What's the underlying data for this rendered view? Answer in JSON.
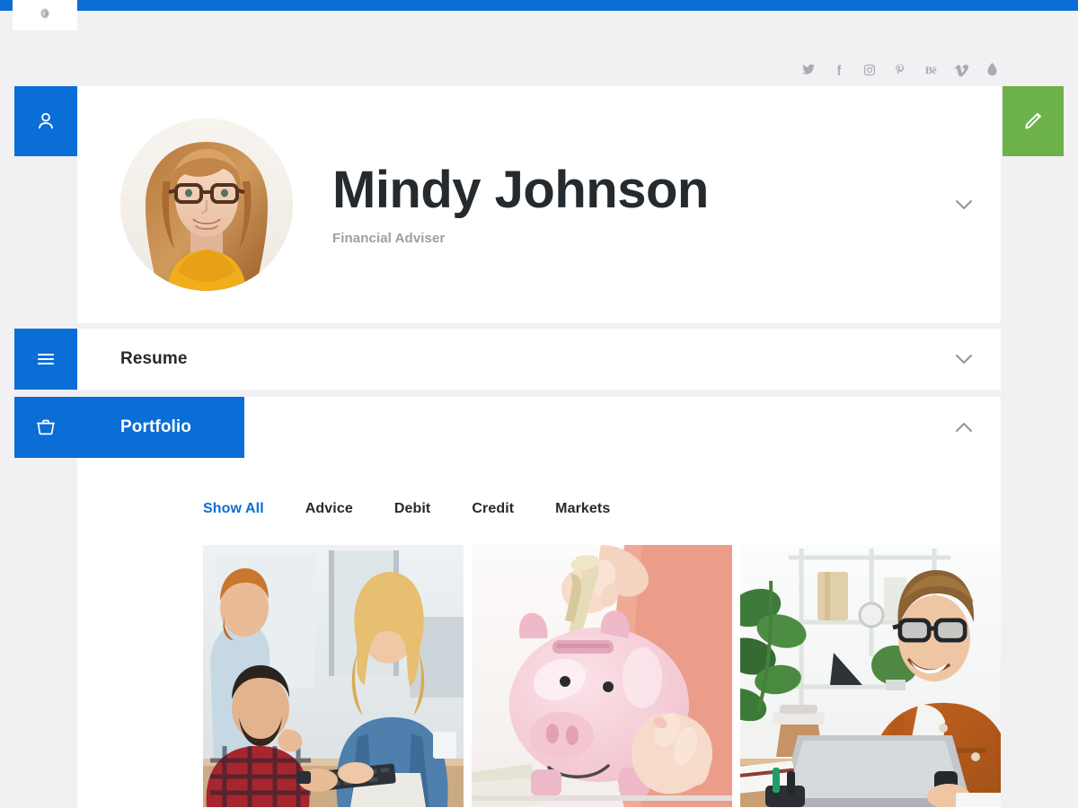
{
  "topbar": {
    "accent_color": "#0a6ed6",
    "brightness_toggle": "brightness-icon"
  },
  "social": {
    "items": [
      {
        "name": "twitter",
        "label": "Twitter"
      },
      {
        "name": "facebook",
        "label": "Facebook"
      },
      {
        "name": "instagram",
        "label": "Instagram"
      },
      {
        "name": "pinterest",
        "label": "Pinterest"
      },
      {
        "name": "behance",
        "label": "Behance"
      },
      {
        "name": "vimeo",
        "label": "Vimeo"
      },
      {
        "name": "dribbble",
        "label": "Dribbble"
      }
    ]
  },
  "profile": {
    "name": "Mindy Johnson",
    "role": "Financial Adviser",
    "avatar_alt": "portrait of a smiling woman with glasses wearing a yellow top",
    "collapse_icon": "chevron-down-icon",
    "side_icon": "user-icon",
    "edit_icon": "pencil-icon",
    "edit_color": "#6cb14a"
  },
  "sections": [
    {
      "id": "resume",
      "title": "Resume",
      "expanded": false,
      "chevron": "chevron-down-icon",
      "side_icon": "menu-icon"
    },
    {
      "id": "portfolio",
      "title": "Portfolio",
      "expanded": true,
      "chevron": "chevron-up-icon",
      "side_icon": "briefcase-icon"
    }
  ],
  "portfolio": {
    "filters": [
      {
        "label": "Show All",
        "active": true
      },
      {
        "label": "Advice",
        "active": false
      },
      {
        "label": "Debit",
        "active": false
      },
      {
        "label": "Credit",
        "active": false
      },
      {
        "label": "Markets",
        "active": false
      }
    ],
    "active_filter_color": "#0a6ed6",
    "items": [
      {
        "alt": "three colleagues reviewing work at an office desk with a keyboard"
      },
      {
        "alt": "hand dropping a rolled banknote into a pink piggy bank"
      },
      {
        "alt": "man in rust jacket and glasses smiling while working on a laptop"
      }
    ]
  },
  "colors": {
    "page_background": "#f1f1f3",
    "card_background": "#ffffff",
    "accent_blue": "#0a6ed6",
    "accent_green": "#6cb14a",
    "heading_text": "#252a2e",
    "muted_text": "#9aa0a8"
  }
}
